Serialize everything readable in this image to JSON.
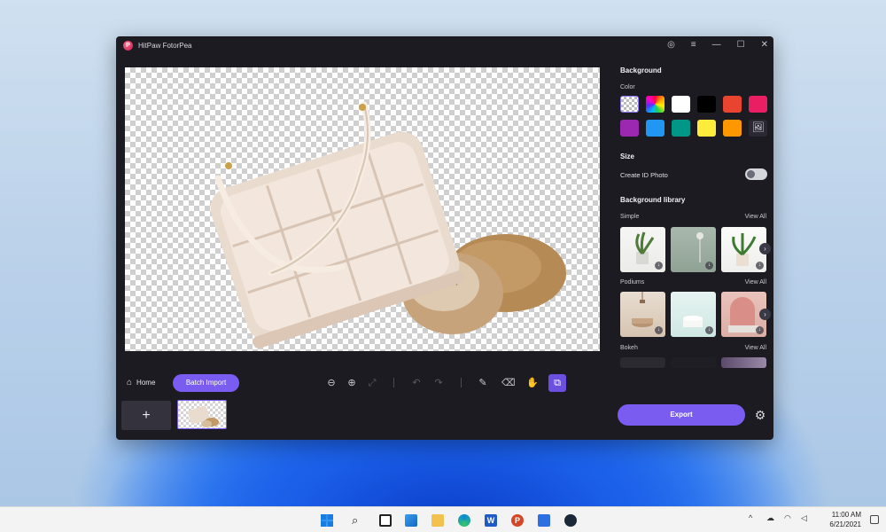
{
  "window": {
    "title": "HitPaw FotorPea"
  },
  "panel": {
    "background_heading": "Background",
    "color_label": "Color",
    "swatches": [
      "transparent",
      "rainbow",
      "#ffffff",
      "#000000",
      "#e8442f",
      "#e91e63",
      "#9c27b0",
      "#2196f3",
      "#009688",
      "#ffeb3b",
      "#ff9800",
      "custom-image"
    ],
    "size_heading": "Size",
    "create_id_photo_label": "Create ID Photo",
    "create_id_photo_on": false,
    "library_heading": "Background library",
    "categories": [
      {
        "name": "Simple",
        "view_all": "View All"
      },
      {
        "name": "Podiums",
        "view_all": "View All"
      },
      {
        "name": "Bokeh",
        "view_all": "View All"
      }
    ]
  },
  "bottom": {
    "home_label": "Home",
    "batch_import_label": "Batch Import",
    "add_label": "+",
    "export_label": "Export"
  },
  "taskbar": {
    "time": "11:00 AM",
    "date": "6/21/2021"
  },
  "colors": {
    "accent": "#7a5cf0",
    "window_bg": "#1c1b22"
  }
}
